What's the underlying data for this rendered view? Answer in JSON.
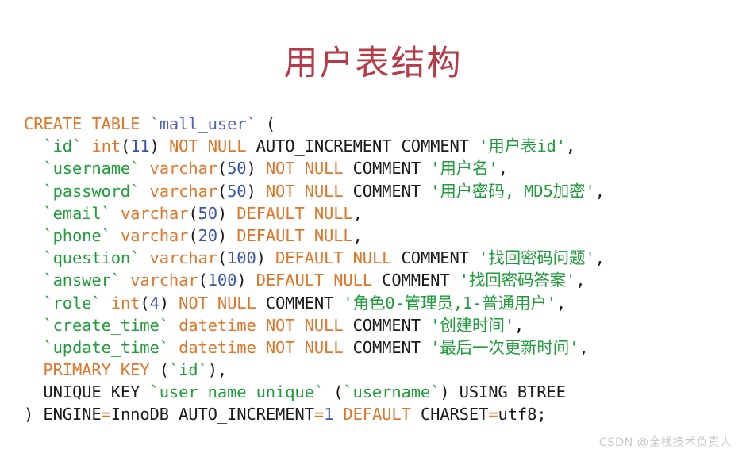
{
  "slide": {
    "title": "用户表结构",
    "title_color": "#b63a48",
    "background_color": "#ffffff"
  },
  "palette": {
    "keyword": "#e0762a",
    "identifier": "#1f9d3a",
    "string": "#1f9d3a",
    "number": "#3a55a8",
    "table_name": "#4d63b6",
    "plain": "#1a1a1a",
    "watermark": "#c9c9c9"
  },
  "code": {
    "language": "sql",
    "statement_type": "CREATE TABLE",
    "table_name": "mall_user",
    "engine": "InnoDB",
    "auto_increment": "1",
    "charset": "utf8",
    "lines": [
      {
        "n": 1,
        "text": "CREATE TABLE `mall_user` (",
        "tokens": [
          {
            "t": "CREATE",
            "c": "kw"
          },
          {
            "t": " ",
            "c": "pl"
          },
          {
            "t": "TABLE",
            "c": "kw"
          },
          {
            "t": " ",
            "c": "pl"
          },
          {
            "t": "`mall_user`",
            "c": "tbl"
          },
          {
            "t": " (",
            "c": "pl"
          }
        ]
      },
      {
        "n": 2,
        "text": "  `id` int(11) NOT NULL AUTO_INCREMENT COMMENT '用户表id',",
        "tokens": [
          {
            "t": "  ",
            "c": "pl"
          },
          {
            "t": "`id`",
            "c": "id"
          },
          {
            "t": " ",
            "c": "pl"
          },
          {
            "t": "int",
            "c": "kw"
          },
          {
            "t": "(",
            "c": "pl"
          },
          {
            "t": "11",
            "c": "num"
          },
          {
            "t": ") ",
            "c": "pl"
          },
          {
            "t": "NOT NULL",
            "c": "kw"
          },
          {
            "t": " AUTO_INCREMENT COMMENT ",
            "c": "pl"
          },
          {
            "t": "'用户表id'",
            "c": "str"
          },
          {
            "t": ",",
            "c": "pl"
          }
        ]
      },
      {
        "n": 3,
        "text": "  `username` varchar(50) NOT NULL COMMENT '用户名',",
        "tokens": [
          {
            "t": "  ",
            "c": "pl"
          },
          {
            "t": "`username`",
            "c": "id"
          },
          {
            "t": " ",
            "c": "pl"
          },
          {
            "t": "varchar",
            "c": "kw"
          },
          {
            "t": "(",
            "c": "pl"
          },
          {
            "t": "50",
            "c": "num"
          },
          {
            "t": ") ",
            "c": "pl"
          },
          {
            "t": "NOT NULL",
            "c": "kw"
          },
          {
            "t": " COMMENT ",
            "c": "pl"
          },
          {
            "t": "'用户名'",
            "c": "str"
          },
          {
            "t": ",",
            "c": "pl"
          }
        ]
      },
      {
        "n": 4,
        "text": "  `password` varchar(50) NOT NULL COMMENT '用户密码, MD5加密',",
        "tokens": [
          {
            "t": "  ",
            "c": "pl"
          },
          {
            "t": "`password`",
            "c": "id"
          },
          {
            "t": " ",
            "c": "pl"
          },
          {
            "t": "varchar",
            "c": "kw"
          },
          {
            "t": "(",
            "c": "pl"
          },
          {
            "t": "50",
            "c": "num"
          },
          {
            "t": ") ",
            "c": "pl"
          },
          {
            "t": "NOT NULL",
            "c": "kw"
          },
          {
            "t": " COMMENT ",
            "c": "pl"
          },
          {
            "t": "'用户密码, MD5加密'",
            "c": "str"
          },
          {
            "t": ",",
            "c": "pl"
          }
        ]
      },
      {
        "n": 5,
        "text": "  `email` varchar(50) DEFAULT NULL,",
        "tokens": [
          {
            "t": "  ",
            "c": "pl"
          },
          {
            "t": "`email`",
            "c": "id"
          },
          {
            "t": " ",
            "c": "pl"
          },
          {
            "t": "varchar",
            "c": "kw"
          },
          {
            "t": "(",
            "c": "pl"
          },
          {
            "t": "50",
            "c": "num"
          },
          {
            "t": ") ",
            "c": "pl"
          },
          {
            "t": "DEFAULT NULL",
            "c": "kw"
          },
          {
            "t": ",",
            "c": "pl"
          }
        ]
      },
      {
        "n": 6,
        "text": "  `phone` varchar(20) DEFAULT NULL,",
        "tokens": [
          {
            "t": "  ",
            "c": "pl"
          },
          {
            "t": "`phone`",
            "c": "id"
          },
          {
            "t": " ",
            "c": "pl"
          },
          {
            "t": "varchar",
            "c": "kw"
          },
          {
            "t": "(",
            "c": "pl"
          },
          {
            "t": "20",
            "c": "num"
          },
          {
            "t": ") ",
            "c": "pl"
          },
          {
            "t": "DEFAULT NULL",
            "c": "kw"
          },
          {
            "t": ",",
            "c": "pl"
          }
        ]
      },
      {
        "n": 7,
        "text": "  `question` varchar(100) DEFAULT NULL COMMENT '找回密码问题',",
        "tokens": [
          {
            "t": "  ",
            "c": "pl"
          },
          {
            "t": "`question`",
            "c": "id"
          },
          {
            "t": " ",
            "c": "pl"
          },
          {
            "t": "varchar",
            "c": "kw"
          },
          {
            "t": "(",
            "c": "pl"
          },
          {
            "t": "100",
            "c": "num"
          },
          {
            "t": ") ",
            "c": "pl"
          },
          {
            "t": "DEFAULT NULL",
            "c": "kw"
          },
          {
            "t": " COMMENT ",
            "c": "pl"
          },
          {
            "t": "'找回密码问题'",
            "c": "str"
          },
          {
            "t": ",",
            "c": "pl"
          }
        ]
      },
      {
        "n": 8,
        "text": "  `answer` varchar(100) DEFAULT NULL COMMENT '找回密码答案',",
        "tokens": [
          {
            "t": "  ",
            "c": "pl"
          },
          {
            "t": "`answer`",
            "c": "id"
          },
          {
            "t": " ",
            "c": "pl"
          },
          {
            "t": "varchar",
            "c": "kw"
          },
          {
            "t": "(",
            "c": "pl"
          },
          {
            "t": "100",
            "c": "num"
          },
          {
            "t": ") ",
            "c": "pl"
          },
          {
            "t": "DEFAULT NULL",
            "c": "kw"
          },
          {
            "t": " COMMENT ",
            "c": "pl"
          },
          {
            "t": "'找回密码答案'",
            "c": "str"
          },
          {
            "t": ",",
            "c": "pl"
          }
        ]
      },
      {
        "n": 9,
        "text": "  `role` int(4) NOT NULL COMMENT '角色0-管理员,1-普通用户',",
        "tokens": [
          {
            "t": "  ",
            "c": "pl"
          },
          {
            "t": "`role`",
            "c": "id"
          },
          {
            "t": " ",
            "c": "pl"
          },
          {
            "t": "int",
            "c": "kw"
          },
          {
            "t": "(",
            "c": "pl"
          },
          {
            "t": "4",
            "c": "num"
          },
          {
            "t": ") ",
            "c": "pl"
          },
          {
            "t": "NOT NULL",
            "c": "kw"
          },
          {
            "t": " COMMENT ",
            "c": "pl"
          },
          {
            "t": "'角色0-管理员,1-普通用户'",
            "c": "str"
          },
          {
            "t": ",",
            "c": "pl"
          }
        ]
      },
      {
        "n": 10,
        "text": "  `create_time` datetime NOT NULL COMMENT '创建时间',",
        "tokens": [
          {
            "t": "  ",
            "c": "pl"
          },
          {
            "t": "`create_time`",
            "c": "id"
          },
          {
            "t": " ",
            "c": "pl"
          },
          {
            "t": "datetime",
            "c": "kw"
          },
          {
            "t": " ",
            "c": "pl"
          },
          {
            "t": "NOT NULL",
            "c": "kw"
          },
          {
            "t": " COMMENT ",
            "c": "pl"
          },
          {
            "t": "'创建时间'",
            "c": "str"
          },
          {
            "t": ",",
            "c": "pl"
          }
        ]
      },
      {
        "n": 11,
        "text": "  `update_time` datetime NOT NULL COMMENT '最后一次更新时间',",
        "tokens": [
          {
            "t": "  ",
            "c": "pl"
          },
          {
            "t": "`update_time`",
            "c": "id"
          },
          {
            "t": " ",
            "c": "pl"
          },
          {
            "t": "datetime",
            "c": "kw"
          },
          {
            "t": " ",
            "c": "pl"
          },
          {
            "t": "NOT NULL",
            "c": "kw"
          },
          {
            "t": " COMMENT ",
            "c": "pl"
          },
          {
            "t": "'最后一次更新时间'",
            "c": "str"
          },
          {
            "t": ",",
            "c": "pl"
          }
        ]
      },
      {
        "n": 12,
        "text": "  PRIMARY KEY (`id`),",
        "tokens": [
          {
            "t": "  ",
            "c": "pl"
          },
          {
            "t": "PRIMARY KEY",
            "c": "kw"
          },
          {
            "t": " (",
            "c": "pl"
          },
          {
            "t": "`id`",
            "c": "id"
          },
          {
            "t": "),",
            "c": "pl"
          }
        ]
      },
      {
        "n": 13,
        "text": "  UNIQUE KEY `user_name_unique` (`username`) USING BTREE",
        "tokens": [
          {
            "t": "  UNIQUE KEY ",
            "c": "pl"
          },
          {
            "t": "`user_name_unique`",
            "c": "id"
          },
          {
            "t": " (",
            "c": "pl"
          },
          {
            "t": "`username`",
            "c": "id"
          },
          {
            "t": ") USING BTREE",
            "c": "pl"
          }
        ]
      },
      {
        "n": 14,
        "text": ") ENGINE=InnoDB AUTO_INCREMENT=1 DEFAULT CHARSET=utf8;",
        "tokens": [
          {
            "t": ") ENGINE",
            "c": "pl"
          },
          {
            "t": "=",
            "c": "op"
          },
          {
            "t": "InnoDB AUTO_INCREMENT",
            "c": "pl"
          },
          {
            "t": "=",
            "c": "op"
          },
          {
            "t": "1",
            "c": "num"
          },
          {
            "t": " ",
            "c": "pl"
          },
          {
            "t": "DEFAULT",
            "c": "kw"
          },
          {
            "t": " CHARSET",
            "c": "pl"
          },
          {
            "t": "=",
            "c": "op"
          },
          {
            "t": "utf8;",
            "c": "pl"
          }
        ]
      }
    ]
  },
  "watermark": {
    "text": "CSDN @全栈技术负责人"
  }
}
